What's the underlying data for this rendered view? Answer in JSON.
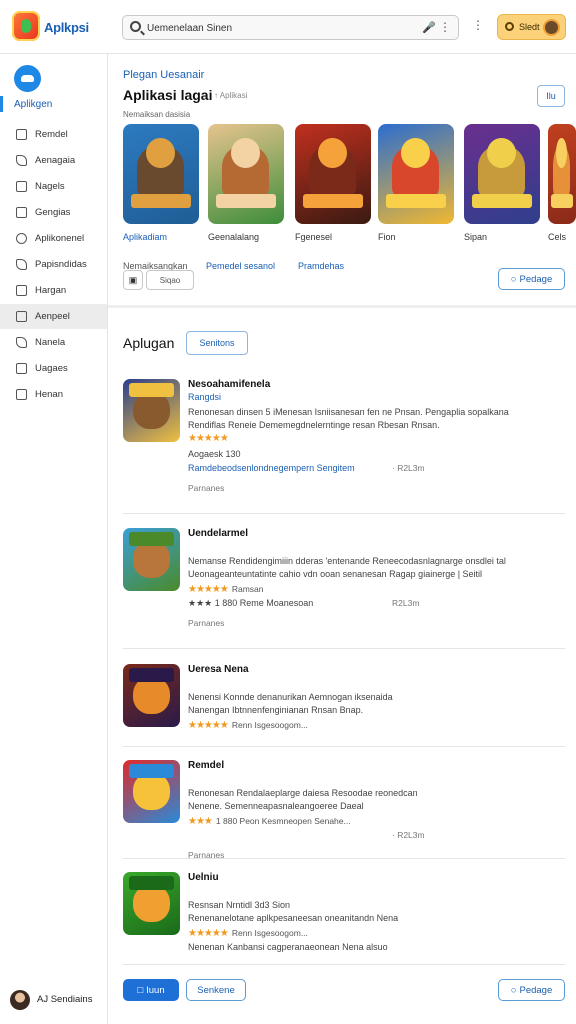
{
  "header": {
    "brand": "Aplkpsi",
    "search_value": "Uemenelaan Sinen",
    "signin_label": "Sledt"
  },
  "sidebar": {
    "title": "Aplikgen",
    "items": [
      {
        "label": "Remdel",
        "icon": "box-icon"
      },
      {
        "label": "Aenagaia",
        "icon": "tag-icon"
      },
      {
        "label": "Nagels",
        "icon": "grid-icon"
      },
      {
        "label": "Gengias",
        "icon": "chart-icon"
      },
      {
        "label": "Aplikonenel",
        "icon": "compass-icon"
      },
      {
        "label": "Papisndidas",
        "icon": "star-icon"
      },
      {
        "label": "Hargan",
        "icon": "box-icon"
      },
      {
        "label": "Aenpeel",
        "icon": "folder-icon",
        "active": true
      },
      {
        "label": "Nanela",
        "icon": "tag-icon"
      },
      {
        "label": "Uagaes",
        "icon": "grid-icon"
      },
      {
        "label": "Henan",
        "icon": "puzzle-icon"
      }
    ],
    "user_label": "AJ Sendiains"
  },
  "promo": {
    "kicker": "Plegan Uesanair",
    "title": "Aplikasi lagai",
    "badge": "↑ Aplikasi",
    "subtitle": "Nemaiksan dasisia",
    "more_label": "Ilu",
    "cards": [
      {
        "label": "Aplikadiam",
        "blue": true,
        "colors": [
          "#2d7ac0",
          "#6a4a2e",
          "#e0a040",
          "#1f5e96"
        ]
      },
      {
        "label": "Geenalalang",
        "blue": false,
        "colors": [
          "#e6c48e",
          "#b56a33",
          "#f3d2a4",
          "#3d8d3a"
        ]
      },
      {
        "label": "Fgenesel",
        "blue": false,
        "colors": [
          "#c0301e",
          "#7b2a1a",
          "#f6a23a",
          "#3a1a12"
        ]
      },
      {
        "label": "Fion",
        "blue": false,
        "colors": [
          "#2c6dcf",
          "#d8462c",
          "#f8d04a",
          "#f0b830"
        ]
      },
      {
        "label": "Sipan",
        "blue": false,
        "colors": [
          "#6a2f8e",
          "#c79a3b",
          "#f0d04a",
          "#2f3f8c"
        ]
      },
      {
        "label": "Cels",
        "blue": false,
        "colors": [
          "#c0401e",
          "#e6903a",
          "#f8d060",
          "#8a2a1a"
        ]
      }
    ],
    "tag_text": "Nemaiksangkan",
    "tag_link1": "Pemedel sesanol",
    "tag_link2": "Pramdehas",
    "mini_btn2_label": "Siqao",
    "package_label": "Pedage"
  },
  "apps_section": {
    "title": "Aplugan",
    "tab_label": "Senitons",
    "apps": [
      {
        "name": "Nesoahamifenela",
        "sub": "Rangdsi",
        "desc1": "Renonesan dinsen 5 iMenesan Isniisanesan fen ne Pnsan. Pengaplia sopalkana",
        "desc2": "Rendiflas Reneie Dememegdnelerntinge resan Rbesan Rnsan.",
        "stars": "★★★★★",
        "rating": "",
        "line3": "Aogaesk 130",
        "link": "Ramdebeodsenlondnegempern Sengitem",
        "size": "· R2L3m",
        "meta": "Parnanes",
        "colors": [
          "#2b3f8e",
          "#8a5a2f",
          "#f0c040"
        ]
      },
      {
        "name": "Uendelarmel",
        "sub": "",
        "desc1": "Nemanse Rendidengimiiin dderas 'entenande Reneecodasnlagnarge onsdlei tal",
        "desc2": "Ueonageanteuntatinte cahio vdn ooan senanesan Ragap giainerge | Seitil",
        "stars": "★★★★★",
        "rating": "Ramsan",
        "line3": "★★★ 1 880 Reme Moanesoan",
        "link": "",
        "size": "R2L3m",
        "meta": "Parnanes",
        "colors": [
          "#3a9fd8",
          "#b8763a",
          "#4a8a2a"
        ]
      },
      {
        "name": "Ueresa Nena",
        "sub": "",
        "desc1": "Nenensi Konnde denanurikan Aemnogan iksenaida",
        "desc2": "Nanengan Ibtnnenfenginianan Rnsan Bnap.",
        "stars": "★★★★★",
        "rating": "Renn Isgesoogom...",
        "line3": "",
        "link": "",
        "size": "",
        "meta": "",
        "colors": [
          "#7a2a1a",
          "#e68a2a",
          "#2a1a4a"
        ]
      },
      {
        "name": "Remdel",
        "sub": "",
        "desc1": "Renonesan Rendalaeplarge daiesa Resoodae reonedcan",
        "desc2": "Nenene. Semenneapasnaleangoeree Daeal",
        "stars": "★★★",
        "rating": "1 880 Peon Kesmneopen Senahe...",
        "line3": "",
        "link": "",
        "size": "· R2L3m",
        "meta": "Parnanes",
        "colors": [
          "#e02a2a",
          "#f6c23a",
          "#2a8ad8"
        ]
      },
      {
        "name": "Uelniu",
        "sub": "",
        "desc1": "Resnsan Nrntidl 3d3 Sion",
        "desc2": "Renenanelotane aplkpesaneesan oneanitandn Nena",
        "stars": "★★★★★",
        "rating": "Renn Isgesoogom...",
        "line3": "Nenenan Kanbansi cagperanaeonean Nena alsuo",
        "link": "",
        "size": "",
        "meta": "",
        "colors": [
          "#3aa82a",
          "#f0a030",
          "#1a6a1a"
        ]
      }
    ]
  },
  "footer": {
    "primary_label": "Iuun",
    "secondary_label": "Senkene",
    "package_label": "Pedage"
  },
  "colors": {
    "accent": "#1a5fb4",
    "primary_button": "#1e6fd6",
    "signin": "#fbd27a",
    "star": "#f39a1e"
  }
}
